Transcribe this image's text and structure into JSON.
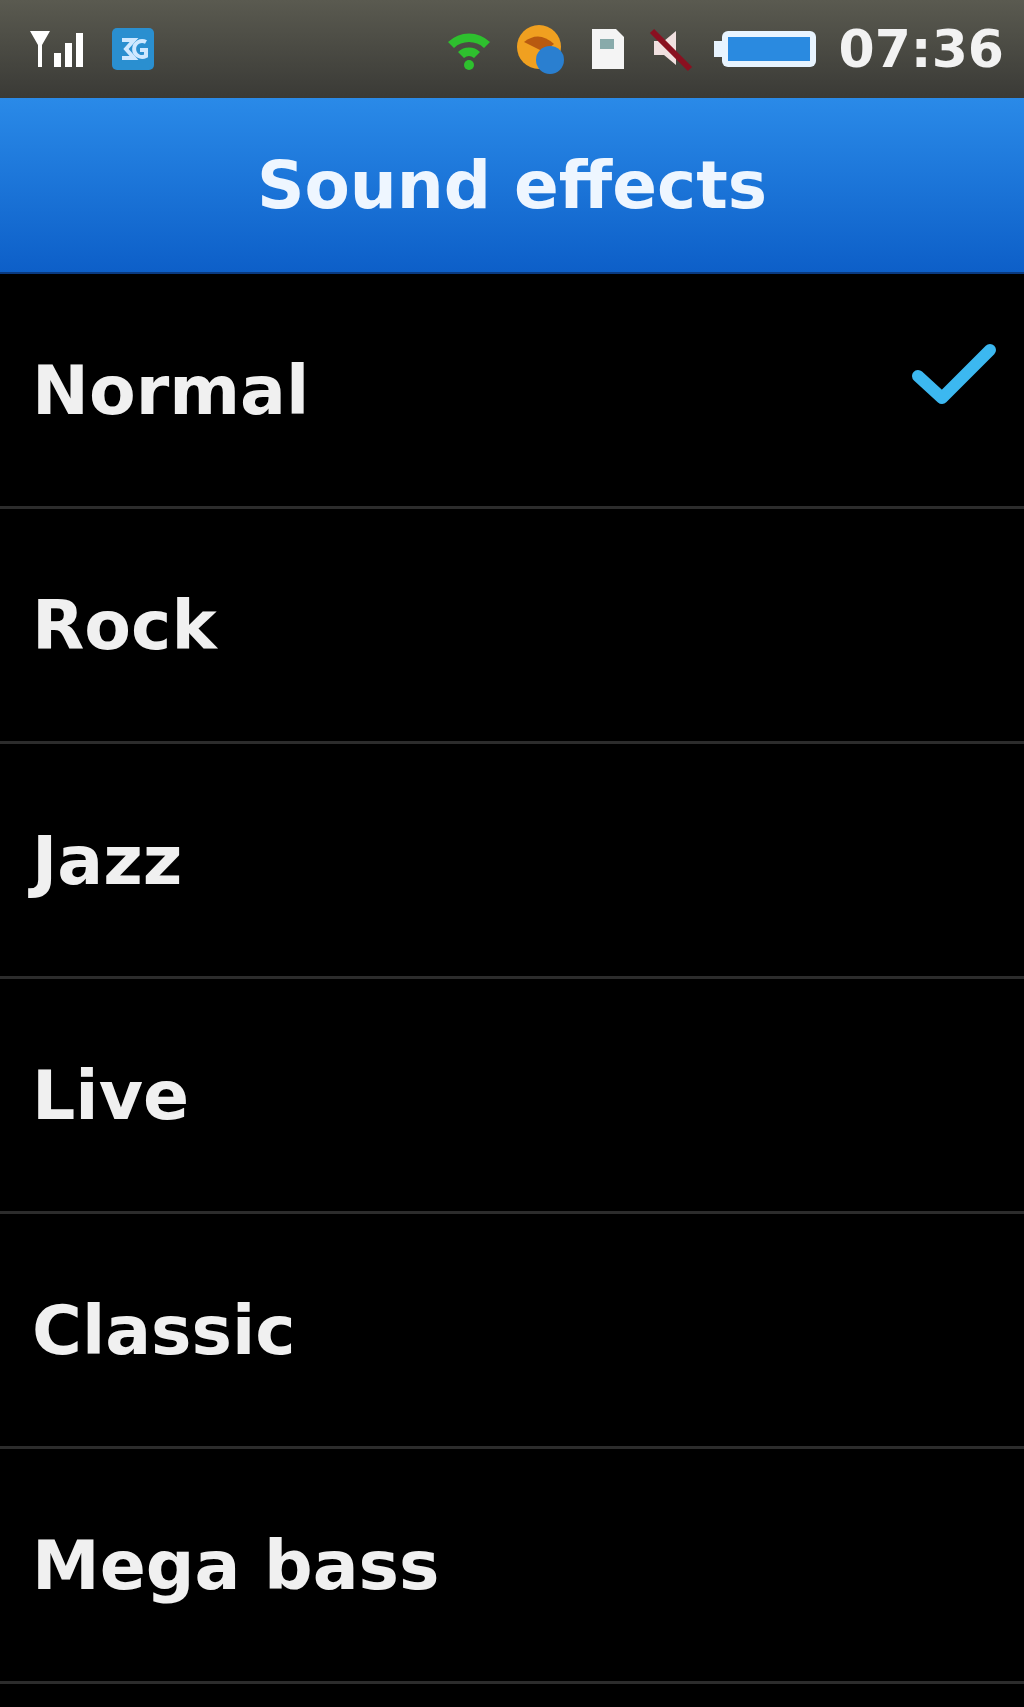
{
  "status_bar": {
    "time": "07:36"
  },
  "title": "Sound effects",
  "items": [
    {
      "label": "Normal",
      "selected": true
    },
    {
      "label": "Rock",
      "selected": false
    },
    {
      "label": "Jazz",
      "selected": false
    },
    {
      "label": "Live",
      "selected": false
    },
    {
      "label": "Classic",
      "selected": false
    },
    {
      "label": "Mega bass",
      "selected": false
    }
  ]
}
